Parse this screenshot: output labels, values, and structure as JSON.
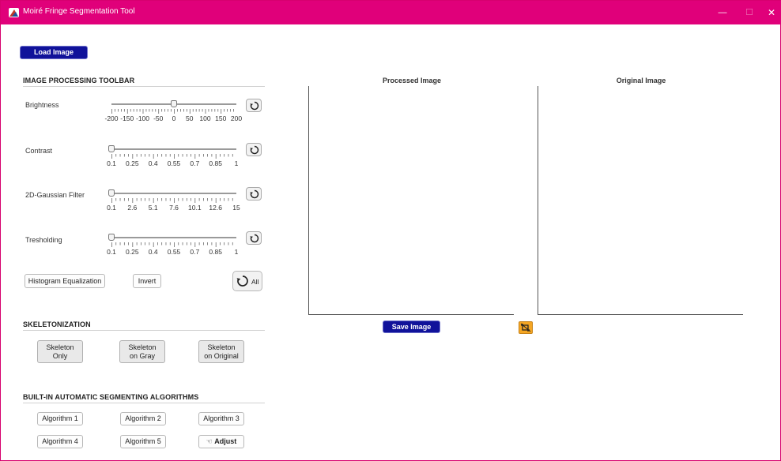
{
  "window": {
    "title": "Moiré Fringe Segmentation Tool",
    "minimize": "—",
    "maximize": "☐",
    "close": "✕",
    "accent": "#e0007a"
  },
  "load_button": "Load Image",
  "toolbar": {
    "title": "IMAGE PROCESSING TOOLBAR",
    "sliders": [
      {
        "label": "Brightness",
        "ticks": [
          "-200",
          "-150",
          "-100",
          "-50",
          "0",
          "50",
          "100",
          "150",
          "200"
        ],
        "value": 0
      },
      {
        "label": "Contrast",
        "ticks": [
          "0.1",
          "0.25",
          "0.4",
          "0.55",
          "0.7",
          "0.85",
          "1"
        ],
        "value": 0.1
      },
      {
        "label": "2D-Gaussian Filter",
        "ticks": [
          "0.1",
          "2.6",
          "5.1",
          "7.6",
          "10.1",
          "12.6",
          "15"
        ],
        "value": 0.1
      },
      {
        "label": "Tresholding",
        "ticks": [
          "0.1",
          "0.25",
          "0.4",
          "0.55",
          "0.7",
          "0.85",
          "1"
        ],
        "value": 0.1
      }
    ],
    "histogram_button": "Histogram Equalization",
    "invert_button": "Invert",
    "reset_all_button": "All"
  },
  "skeleton": {
    "title": "SKELETONIZATION",
    "buttons": [
      {
        "line1": "Skeleton",
        "line2": "Only"
      },
      {
        "line1": "Skeleton",
        "line2": "on Gray"
      },
      {
        "line1": "Skeleton",
        "line2": "on Original"
      }
    ]
  },
  "algorithms": {
    "title": "BUILT-IN AUTOMATIC SEGMENTING ALGORITHMS",
    "buttons": [
      "Algorithm 1",
      "Algorithm 2",
      "Algorithm 3",
      "Algorithm 4",
      "Algorithm 5"
    ],
    "adjust_button": "Adjust"
  },
  "processed": {
    "title": "Processed Image"
  },
  "original": {
    "title": "Original Image"
  },
  "save_button": "Save Image",
  "icons": {
    "app": "app-logo-icon",
    "reset": "reset-rotate-icon",
    "crop": "crop-off-icon",
    "adjust": "hand-pointer-icon"
  }
}
